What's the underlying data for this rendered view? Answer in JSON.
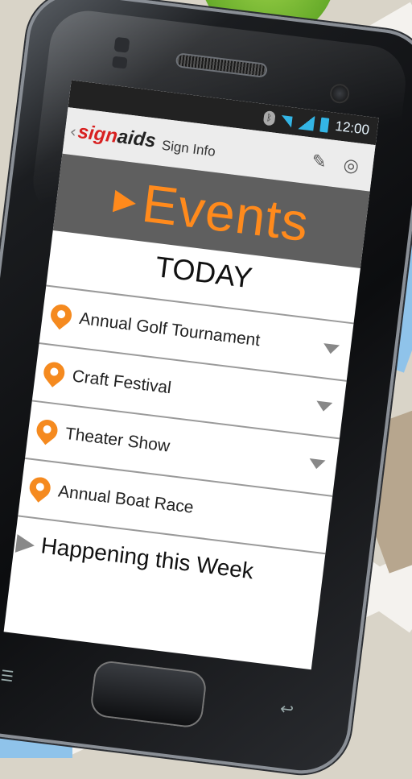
{
  "status_bar": {
    "time": "12:00"
  },
  "app_bar": {
    "back_glyph": "‹",
    "logo_sign": "sign",
    "logo_aids": "aids",
    "title": "Sign Info",
    "icons": [
      "edit-icon",
      "locate-icon"
    ]
  },
  "banner": {
    "title": "Events"
  },
  "section": {
    "today": "TODAY"
  },
  "events": [
    {
      "name": "Annual Golf Tournament"
    },
    {
      "name": "Craft Festival"
    },
    {
      "name": "Theater Show"
    },
    {
      "name": "Annual Boat Race"
    }
  ],
  "week": {
    "label": "Happening this Week"
  },
  "colors": {
    "accent": "#f58a1f",
    "banner_bg": "#5f5f5f",
    "logo_red": "#d82020"
  }
}
